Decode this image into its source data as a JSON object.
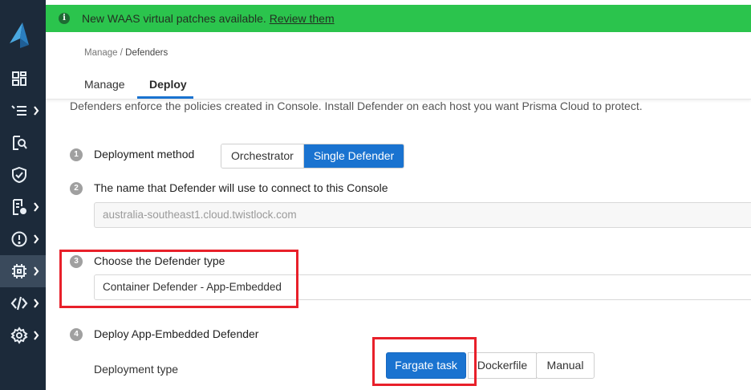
{
  "banner": {
    "message": "New WAAS virtual patches available.",
    "link_text": "Review them",
    "info_glyph": "i"
  },
  "breadcrumb": {
    "parent": "Manage",
    "separator": " / ",
    "current": "Defenders"
  },
  "tabs": [
    {
      "label": "Manage",
      "active": false
    },
    {
      "label": "Deploy",
      "active": true
    }
  ],
  "intro": "Defenders enforce the policies created in Console. Install Defender on each host you want Prisma Cloud to protect.",
  "steps": [
    {
      "number": "1",
      "label": "Deployment method",
      "options": [
        "Orchestrator",
        "Single Defender"
      ],
      "selected": "Single Defender"
    },
    {
      "number": "2",
      "label": "The name that Defender will use to connect to this Console",
      "value": "australia-southeast1.cloud.twistlock.com"
    },
    {
      "number": "3",
      "label": "Choose the Defender type",
      "value": "Container Defender - App-Embedded"
    },
    {
      "number": "4",
      "label": "Deploy App-Embedded Defender",
      "sub_label": "Deployment type",
      "options": [
        "Fargate task",
        "Dockerfile",
        "Manual"
      ],
      "selected": "Fargate task"
    }
  ],
  "sidebar": {
    "icons": [
      "prisma-logo",
      "dashboard-icon",
      "list-icon",
      "search-icon",
      "shield-icon",
      "compliance-icon",
      "alert-icon",
      "defender-chip-icon",
      "code-icon",
      "gear-icon"
    ]
  },
  "colors": {
    "sidebar_bg": "#1c2a3a",
    "banner_green": "#2bc44d",
    "accent_blue": "#1a73d0",
    "highlight_red": "#e8202a"
  }
}
